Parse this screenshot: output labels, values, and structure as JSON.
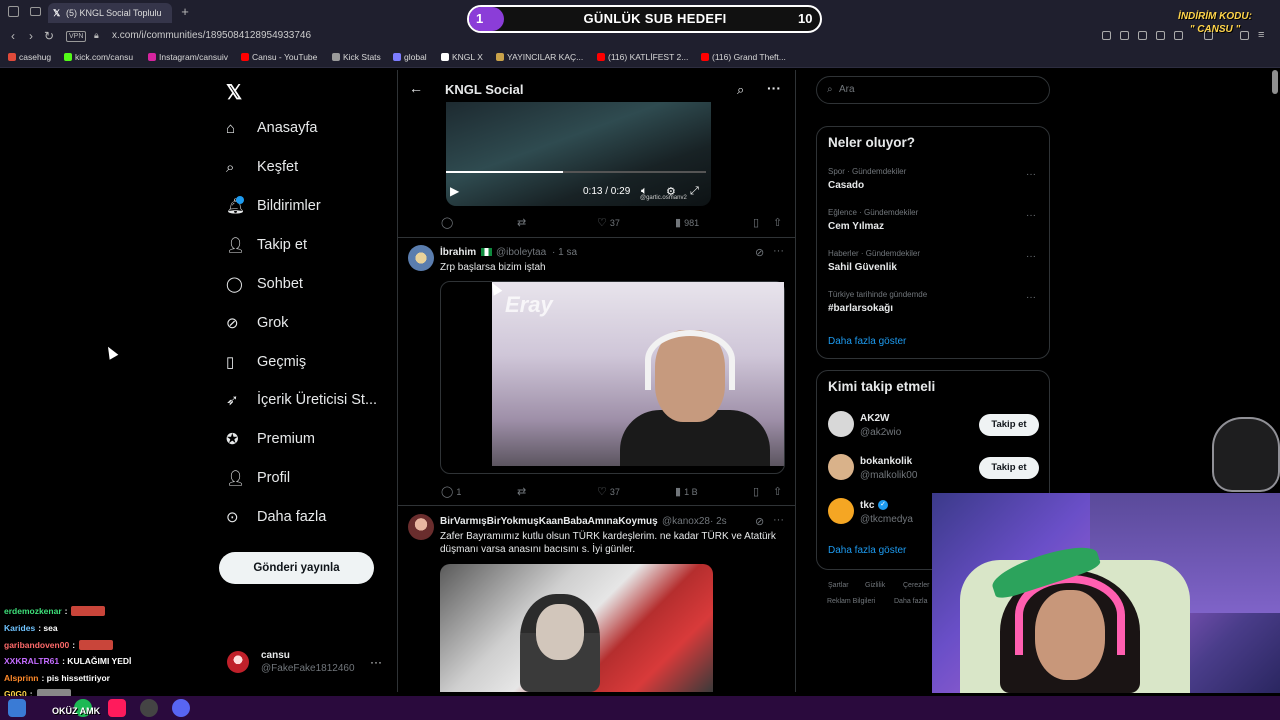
{
  "browser": {
    "tab_title": "(5) KNGL Social Toplulu",
    "url": "x.com/i/communities/1895084128954933746",
    "vpn_label": "VPN",
    "bookmarks": [
      {
        "label": "casehug",
        "color": "#e04a3a"
      },
      {
        "label": "kick.com/cansu",
        "color": "#53fc18"
      },
      {
        "label": "Instagram/cansuiv",
        "color": "#d6249f"
      },
      {
        "label": "Cansu - YouTube",
        "color": "#ff0000"
      },
      {
        "label": "Kick Stats",
        "color": "#9a9a9a"
      },
      {
        "label": "global",
        "color": "#7c7cff"
      },
      {
        "label": "KNGL X",
        "color": "#ffffff"
      },
      {
        "label": "YAYINCILAR KAÇ...",
        "color": "#c9a24a"
      },
      {
        "label": "(116) KATLİFEST 2...",
        "color": "#ff0000"
      },
      {
        "label": "(116) Grand Theft...",
        "color": "#ff0000"
      }
    ]
  },
  "overlay": {
    "sub_goal": {
      "start": "1",
      "title": "GÜNLÜK SUB HEDEFI",
      "end": "10",
      "progress": 0.1
    },
    "discount_line1": "İNDİRİM KODU:",
    "discount_line2": "\" CANSU \""
  },
  "nav": {
    "items": [
      {
        "label": "Anasayfa",
        "icon": "home-icon"
      },
      {
        "label": "Keşfet",
        "icon": "search-icon"
      },
      {
        "label": "Bildirimler",
        "icon": "bell-icon"
      },
      {
        "label": "Takip et",
        "icon": "add-person-icon"
      },
      {
        "label": "Sohbet",
        "icon": "chat-icon"
      },
      {
        "label": "Grok",
        "icon": "grok-icon"
      },
      {
        "label": "Geçmiş",
        "icon": "bookmark-icon"
      },
      {
        "label": "İçerik Üreticisi St...",
        "icon": "rocket-icon"
      },
      {
        "label": "Premium",
        "icon": "verified-icon"
      },
      {
        "label": "Profil",
        "icon": "person-icon"
      },
      {
        "label": "Daha fazla",
        "icon": "more-circle-icon"
      }
    ],
    "post_button": "Gönderi yayınla",
    "account": {
      "name": "cansu",
      "handle": "@FakeFake1812460"
    }
  },
  "community": {
    "title": "KNGL Social",
    "video": {
      "time": "0:13 / 0:29",
      "progress": 0.45,
      "watermark": "@gartic.osmanv2"
    },
    "tweet1_actions": {
      "replies": "",
      "retweets": "",
      "likes": "37",
      "views": "981"
    },
    "tweet2": {
      "name": "İbrahim",
      "handle": "@iboleytaa",
      "time": "· 1 sa",
      "text": "Zrp başlarsa bizim iştah",
      "media_text": "Eray",
      "actions": {
        "replies": "1",
        "retweets": "",
        "likes": "37",
        "views": "1 B"
      }
    },
    "tweet3": {
      "name": "BirVarmışBirYokmuşKaanBabaAmınaKoymuş",
      "handle": "@kanox28",
      "time": "· 2s",
      "text": "Zafer Bayramımız kutlu olsun TÜRK kardeşlerim. ne kadar TÜRK ve Atatürk düşmanı varsa anasını bacısını s. İyi günler."
    }
  },
  "right": {
    "search_placeholder": "Ara",
    "trends_title": "Neler oluyor?",
    "trends": [
      {
        "category": "Spor · Gündemdekiler",
        "name": "Casado"
      },
      {
        "category": "Eğlence · Gündemdekiler",
        "name": "Cem Yılmaz"
      },
      {
        "category": "Haberler · Gündemdekiler",
        "name": "Sahil Güvenlik"
      },
      {
        "category": "Türkiye tarihinde gündemde",
        "name": "#barlarsokağı"
      }
    ],
    "trends_more": "Daha fazla göster",
    "wtf_title": "Kimi takip etmeli",
    "wtf": [
      {
        "name": "AK2W",
        "handle": "@ak2wio",
        "button": "Takip et",
        "color": "#d8d8d8"
      },
      {
        "name": "bokankolik",
        "handle": "@malkolik00",
        "button": "Takip et",
        "color": "#d9b28a"
      },
      {
        "name": "tkc",
        "handle": "@tkcmedya",
        "button": "",
        "color": "#f5a623"
      }
    ],
    "wtf_more": "Daha fazla göster",
    "footer": [
      "Şartlar",
      "Gizlilik",
      "Çerezler",
      "Reklam Bilgileri",
      "Daha fazla"
    ]
  },
  "chat": [
    {
      "user": "erdemozkenar",
      "msg": ":",
      "color": "#3ee07a",
      "emote": "#c9453a"
    },
    {
      "user": "Karides",
      "msg": ": sea",
      "color": "#6fc3ff",
      "emote": ""
    },
    {
      "user": "garibandoven00",
      "msg": ":",
      "color": "#ff6a6a",
      "emote": "#c9453a"
    },
    {
      "user": "XXKRALTR61",
      "msg": ": KULAĞIMI YEDİ",
      "color": "#c46cff",
      "emote": ""
    },
    {
      "user": "Alsprinn",
      "msg": ": pis hissettiriyor",
      "color": "#ff8a2a",
      "emote": ""
    },
    {
      "user": "G0G0",
      "msg": ":",
      "color": "#ffd34a",
      "emote": "#888888"
    }
  ],
  "chat_bottom": "OKÜZ AMK"
}
